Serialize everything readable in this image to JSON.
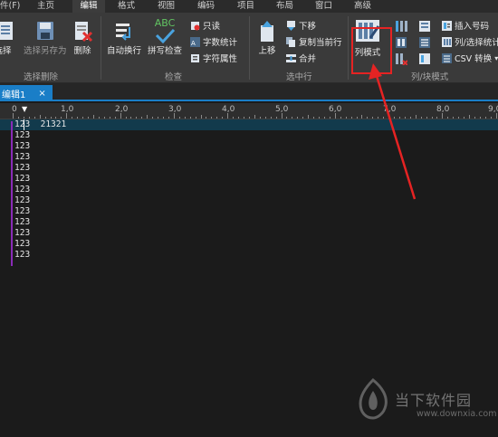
{
  "menu": {
    "tabs": [
      "件(F)",
      "主页",
      "编辑",
      "格式",
      "视图",
      "编码",
      "项目",
      "布局",
      "窗口",
      "高级"
    ],
    "active": "编辑"
  },
  "ribbon": {
    "select_delete_group": {
      "label": "选择删除",
      "select": "选择",
      "select_save_as": "选择另存为",
      "delete": "删除"
    },
    "check_group": {
      "label": "检查",
      "auto_wrap": "自动换行",
      "spell_check": "拼写检查",
      "spell_icon_text": "ABC",
      "readonly": "只读",
      "word_count": "字数统计",
      "char_props": "字符属性"
    },
    "selected_line_group": {
      "label": "选中行",
      "move_up": "上移",
      "move_down": "下移",
      "copy_line": "复制当前行",
      "merge": "合并"
    },
    "column_group": {
      "label": "列/块模式",
      "column_mode": "列模式",
      "insert_number": "插入号码",
      "column_select_stats": "列/选择统计",
      "csv_convert": "CSV 转换"
    }
  },
  "document": {
    "tab_title": "编辑1",
    "close_glyph": "×",
    "ruler_labels": [
      "0",
      "1,0",
      "2,0",
      "3,0",
      "4,0",
      "5,0",
      "6,0",
      "7,0",
      "8,0",
      "9,0"
    ],
    "lines": [
      "123  21321",
      "123",
      "123",
      "123",
      "123",
      "123",
      "123",
      "123",
      "123",
      "123",
      "123",
      "123",
      "123"
    ]
  },
  "watermark": {
    "brand": "当下软件园",
    "url": "www.downxia.com"
  },
  "colors": {
    "accent": "#1a7ec7",
    "annotation": "#e52323",
    "gutter": "#8a2bb7",
    "current_line": "#123a4c"
  }
}
